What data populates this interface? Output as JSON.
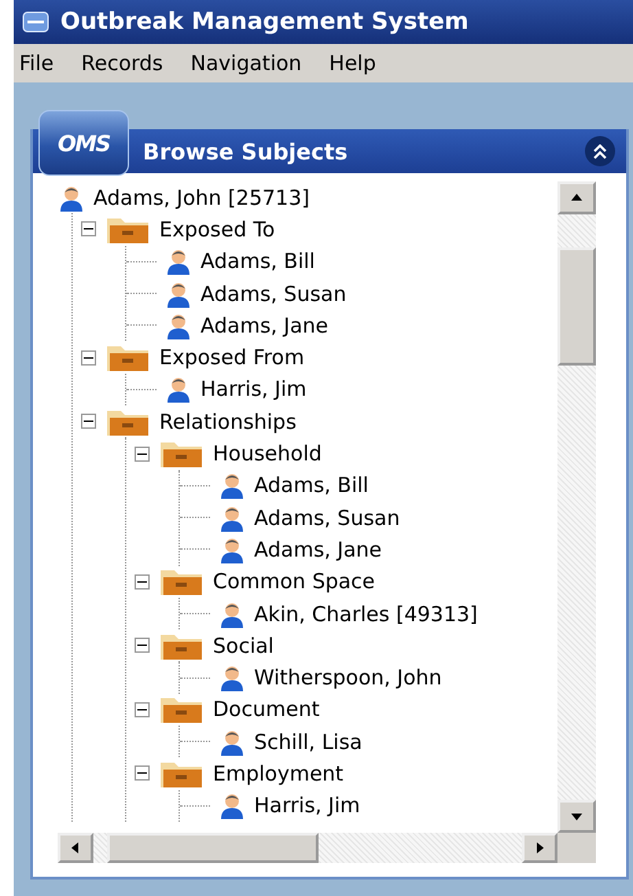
{
  "window": {
    "title": "Outbreak Management System"
  },
  "menu": [
    "File",
    "Records",
    "Navigation",
    "Help"
  ],
  "panel": {
    "logo": "OMS",
    "title": "Browse Subjects"
  },
  "tree": [
    {
      "kind": "person",
      "label": "Adams, John [25713]",
      "children": [
        {
          "kind": "folder",
          "label": "Exposed To",
          "expanded": true,
          "children": [
            {
              "kind": "person",
              "label": "Adams, Bill"
            },
            {
              "kind": "person",
              "label": "Adams, Susan"
            },
            {
              "kind": "person",
              "label": "Adams, Jane"
            }
          ]
        },
        {
          "kind": "folder",
          "label": "Exposed From",
          "expanded": true,
          "children": [
            {
              "kind": "person",
              "label": "Harris, Jim"
            }
          ]
        },
        {
          "kind": "folder",
          "label": "Relationships",
          "expanded": true,
          "children": [
            {
              "kind": "folder",
              "label": "Household",
              "expanded": true,
              "children": [
                {
                  "kind": "person",
                  "label": "Adams, Bill"
                },
                {
                  "kind": "person",
                  "label": "Adams, Susan"
                },
                {
                  "kind": "person",
                  "label": "Adams, Jane"
                }
              ]
            },
            {
              "kind": "folder",
              "label": "Common Space",
              "expanded": true,
              "children": [
                {
                  "kind": "person",
                  "label": "Akin, Charles [49313]"
                }
              ]
            },
            {
              "kind": "folder",
              "label": "Social",
              "expanded": true,
              "children": [
                {
                  "kind": "person",
                  "label": "Witherspoon, John"
                }
              ]
            },
            {
              "kind": "folder",
              "label": "Document",
              "expanded": true,
              "children": [
                {
                  "kind": "person",
                  "label": "Schill, Lisa"
                }
              ]
            },
            {
              "kind": "folder",
              "label": "Employment",
              "expanded": true,
              "children": [
                {
                  "kind": "person",
                  "label": "Harris, Jim"
                }
              ]
            }
          ]
        }
      ]
    }
  ]
}
